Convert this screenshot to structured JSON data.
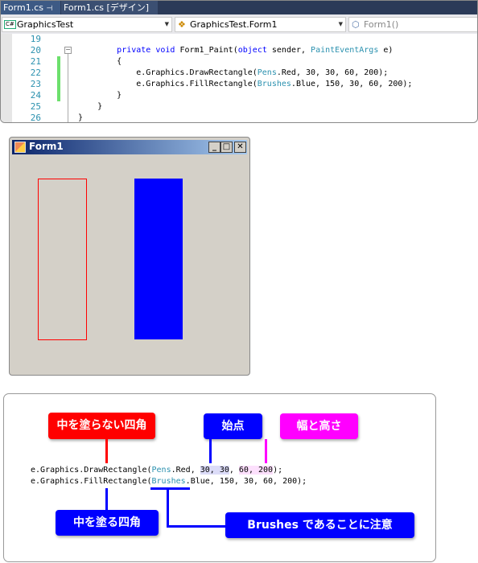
{
  "tabs": [
    {
      "label": "Form1.cs",
      "pin": "⊣",
      "close": "✕"
    },
    {
      "label": "Form1.cs [デザイン]"
    }
  ],
  "dropdowns": {
    "project": "GraphicsTest",
    "class": "GraphicsTest.Form1",
    "member": "Form1()"
  },
  "code_lines": [
    {
      "n": "19",
      "text": ""
    },
    {
      "n": "20",
      "text": "        private void Form1_Paint(object sender, PaintEventArgs e)"
    },
    {
      "n": "21",
      "text": "        {"
    },
    {
      "n": "22",
      "text": "            e.Graphics.DrawRectangle(Pens.Red, 30, 30, 60, 200);"
    },
    {
      "n": "23",
      "text": "            e.Graphics.FillRectangle(Brushes.Blue, 150, 30, 60, 200);"
    },
    {
      "n": "24",
      "text": "        }"
    },
    {
      "n": "25",
      "text": "    }"
    },
    {
      "n": "26",
      "text": "}"
    }
  ],
  "form": {
    "title": "Form1",
    "min": "_",
    "max": "□",
    "close": "✕"
  },
  "colors": {
    "red": "#ff0000",
    "blue": "#0000ff",
    "magenta": "#ff00ff"
  },
  "callout": {
    "line1": {
      "a": "e.Graphics.DrawRectangle(",
      "b": "Pens",
      "c": ".Red, ",
      "d": "30, 30",
      "e": ", ",
      "f": "60, 200",
      "g": ");"
    },
    "line2": {
      "a": "e.Graphics.FillRectangle(",
      "b": "Brushes",
      "c": ".Blue, 150, 30, 60, 200);"
    },
    "labels": {
      "draw": "中を塗らない四角",
      "start": "始点",
      "size": "幅と高さ",
      "fill": "中を塗る四角",
      "brushes": "Brushes であることに注意"
    }
  }
}
